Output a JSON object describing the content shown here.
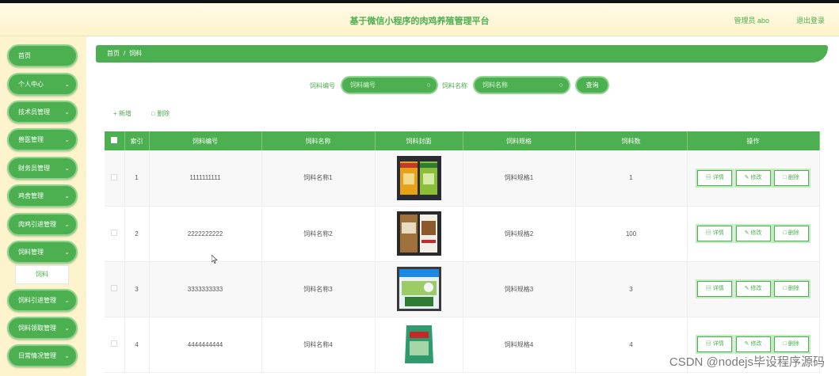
{
  "header": {
    "title": "基于微信小程序的肉鸡养殖管理平台",
    "user": "管理员 abo",
    "logout": "退出登录"
  },
  "sidebar": {
    "items": [
      {
        "label": "首页",
        "chevron": false
      },
      {
        "label": "个人中心",
        "chevron": true
      },
      {
        "label": "技术员管理",
        "chevron": true
      },
      {
        "label": "兽医管理",
        "chevron": true
      },
      {
        "label": "财务员管理",
        "chevron": true
      },
      {
        "label": "鸡舍管理",
        "chevron": true
      },
      {
        "label": "肉鸡引进管理",
        "chevron": true
      },
      {
        "label": "饲料管理",
        "chevron": true
      },
      {
        "label": "饲料引进管理",
        "chevron": true
      },
      {
        "label": "饲料领取管理",
        "chevron": true
      },
      {
        "label": "日常情况管理",
        "chevron": true
      }
    ],
    "subitem": "饲料"
  },
  "breadcrumb": {
    "home": "首页",
    "sep": "/",
    "current": "饲料"
  },
  "search": {
    "code_label": "饲料编号",
    "code_placeholder": "饲料编号",
    "name_label": "饲料名称",
    "name_placeholder": "饲料名称",
    "query": "查询"
  },
  "toolbar": {
    "add": "新增",
    "delete": "删除"
  },
  "table": {
    "headers": [
      "索引",
      "饲料编号",
      "饲料名称",
      "饲料封面",
      "饲料规格",
      "饲料数",
      "操作"
    ],
    "rows": [
      {
        "index": "1",
        "code": "1111111111",
        "name": "饲料名称1",
        "spec": "饲料规格1",
        "count": "1"
      },
      {
        "index": "2",
        "code": "2222222222",
        "name": "饲料名称2",
        "spec": "饲料规格2",
        "count": "100"
      },
      {
        "index": "3",
        "code": "3333333333",
        "name": "饲料名称3",
        "spec": "饲料规格3",
        "count": "3"
      },
      {
        "index": "4",
        "code": "4444444444",
        "name": "饲料名称4",
        "spec": "饲料规格4",
        "count": "4"
      }
    ],
    "actions": {
      "detail": "详情",
      "edit": "修改",
      "delete": "删除"
    }
  },
  "watermark": "CSDN @nodejs毕设程序源码",
  "colors": {
    "primary": "#4caf50",
    "header_bg": "#fdf3cc"
  }
}
